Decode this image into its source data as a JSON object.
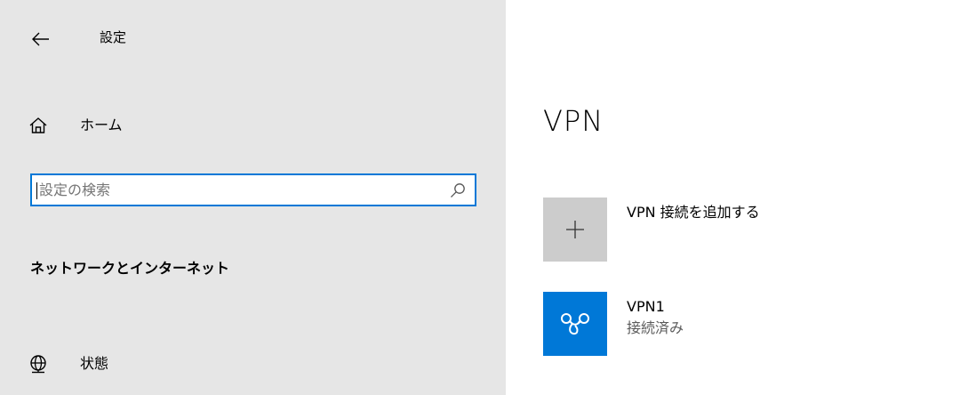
{
  "window": {
    "title": "設定"
  },
  "sidebar": {
    "home_label": "ホーム",
    "search": {
      "placeholder": "設定の検索",
      "value": ""
    },
    "section_header": "ネットワークとインターネット",
    "items": [
      {
        "label": "状態",
        "icon": "globe-icon"
      }
    ]
  },
  "main": {
    "title": "VPN",
    "add_vpn_label": "VPN 接続を追加する",
    "connections": [
      {
        "name": "VPN1",
        "status": "接続済み",
        "icon": "vpn-icon"
      }
    ]
  },
  "colors": {
    "accent": "#0078d7",
    "sidebar_bg": "#e6e6e6",
    "add_tile_bg": "#cccccc"
  }
}
